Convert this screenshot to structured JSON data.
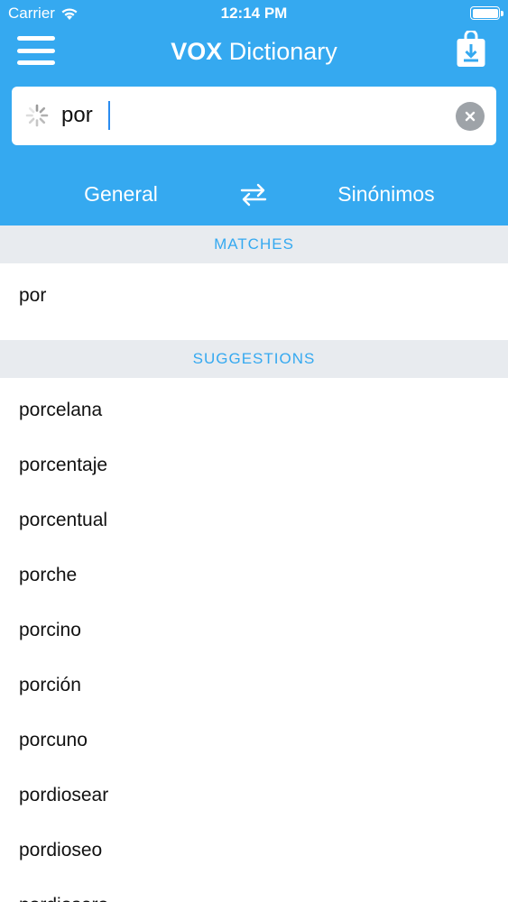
{
  "status_bar": {
    "carrier": "Carrier",
    "time": "12:14 PM",
    "battery_level": 1.0
  },
  "nav": {
    "brand": "VOX",
    "title": " Dictionary"
  },
  "search": {
    "value": "por",
    "placeholder": ""
  },
  "modes": {
    "left": "General",
    "right": "Sinónimos"
  },
  "matches": {
    "header": "MATCHES",
    "items": [
      "por"
    ]
  },
  "suggestions": {
    "header": "SUGGESTIONS",
    "items": [
      "porcelana",
      "porcentaje",
      "porcentual",
      "porche",
      "porcino",
      "porción",
      "porcuno",
      "pordiosear",
      "pordioseo",
      "pordiosero"
    ]
  },
  "colors": {
    "accent": "#35a9f0",
    "section_bg": "#e8ebef"
  }
}
